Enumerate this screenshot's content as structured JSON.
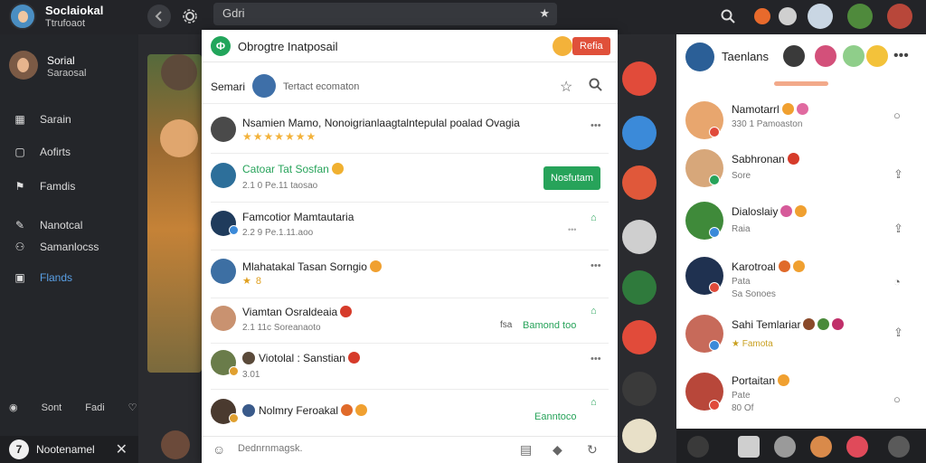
{
  "topbar": {
    "brand_name": "Soclaiokal",
    "brand_sub": "Ttrufoaot",
    "search_value": "Gdri"
  },
  "sidebar": {
    "profile_name": "Sorial",
    "profile_sub": "Saraosal",
    "items": [
      {
        "label": "Sarain",
        "icon": "grid-icon"
      },
      {
        "label": "Aofirts",
        "icon": "square-icon"
      },
      {
        "label": "Famdis",
        "icon": "flag-icon"
      },
      {
        "label": "Nanotcal",
        "icon": "edit-icon"
      },
      {
        "label": "Samanlocss",
        "icon": "people-icon"
      },
      {
        "label": "Flands",
        "icon": "photo-icon"
      }
    ],
    "footer": {
      "a": "Sont",
      "b": "Fadi"
    },
    "bottom_label": "Nootenamel",
    "bottom_badge": "7"
  },
  "modal": {
    "title": "Obrogtre Inatposail",
    "badge": "Refia",
    "sub_label": "Semari",
    "sub_text": "Tertact ecomaton",
    "rows": [
      {
        "name": "Nsamien Mamo, Nonoigrianlaagtalntepulal poalad Ovagia",
        "meta": "",
        "stars": "★★★★★★★",
        "right": "•••"
      },
      {
        "name": "Catoar Tat Sosfan",
        "meta": "2.1  0 Pe.11 taosao",
        "stars": "",
        "right": "Nosfutam"
      },
      {
        "name": "Famcotior Mamtautaria",
        "meta": "2.2 9  Pe.1.11.aoo",
        "stars": "",
        "right": "•••"
      },
      {
        "name": "Mlahatakal Tasan Sorngio",
        "meta": "",
        "stars": "★ 8",
        "right": "•••"
      },
      {
        "name": "Viamtan Osraldeaia",
        "meta": "2.1 11c Soreanaoto",
        "stars": "",
        "right": "Bamond too",
        "right_prefix": "fsa"
      },
      {
        "name": "Viotolal : Sanstian",
        "meta": "3.01",
        "stars": "",
        "right": "•••"
      },
      {
        "name": "Nolmry Feroakal",
        "meta": "",
        "stars": "",
        "right": "Eanntoco"
      }
    ],
    "composer_placeholder": "Dednrnmagsk."
  },
  "rpanel": {
    "title": "Taenlans",
    "friends": [
      {
        "name": "Namotarrl",
        "meta": "330 1 Pamoaston",
        "meta2": ""
      },
      {
        "name": "Sabhronan",
        "meta": "Sore",
        "meta2": ""
      },
      {
        "name": "Dialoslaiy",
        "meta": "Raia",
        "meta2": ""
      },
      {
        "name": "Karotroal",
        "meta": "Pata",
        "meta2": "Sa Sonoes"
      },
      {
        "name": "Sahi Temlariar",
        "meta": "★ Famota",
        "meta2": ""
      },
      {
        "name": "Portaitan",
        "meta": "Pate",
        "meta2": "80 Of"
      }
    ]
  },
  "colors": {
    "accent_green": "#27a35a",
    "accent_red": "#e0503a",
    "link_blue": "#5aa0e6"
  }
}
